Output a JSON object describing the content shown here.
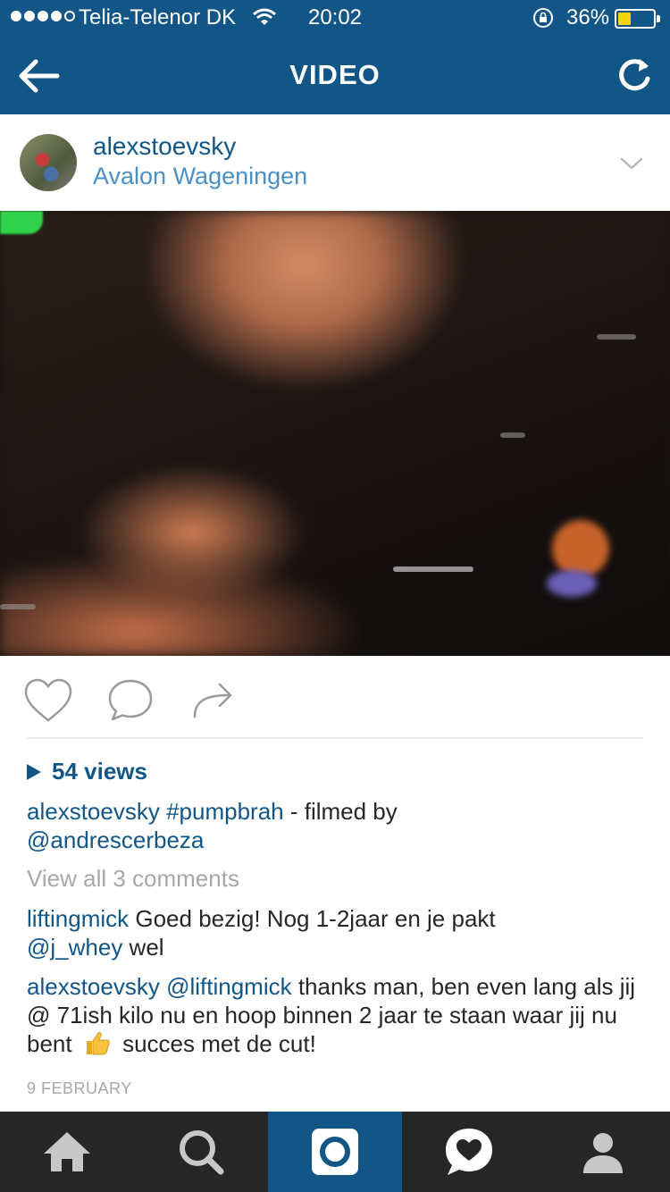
{
  "status_bar": {
    "carrier": "Telia-Telenor DK",
    "time": "20:02",
    "battery_percent": "36%",
    "battery_level": 0.36
  },
  "nav": {
    "title": "VIDEO",
    "back_icon": "back-arrow-icon",
    "refresh_icon": "refresh-icon"
  },
  "post": {
    "username": "alexstoevsky",
    "location": "Avalon Wageningen",
    "views": "54 views",
    "caption": {
      "user": "alexstoevsky",
      "hashtag": "#pumpbrah",
      "text": " - filmed by ",
      "mention": "@andrescerbeza"
    },
    "view_all_comments": "View all 3 comments",
    "comments": [
      {
        "user": "liftingmick",
        "text_before": "Goed bezig! Nog 1-2jaar en je pakt ",
        "mention": "@j_whey",
        "text_after": " wel"
      },
      {
        "user": "alexstoevsky",
        "mention": "@liftingmick",
        "text_before": " thanks man, ben even lang als jij @ 71ish kilo nu en hoop binnen 2 jaar te staan waar jij nu bent",
        "emoji": "thumbs-up-icon",
        "text_after": "succes met de cut!"
      }
    ],
    "date": "9 FEBRUARY"
  },
  "colors": {
    "brand_blue": "#125688",
    "link_blue": "#125688",
    "location_blue": "#4a90c8",
    "tab_bg": "#262626",
    "muted": "#a5a7aa"
  },
  "tabbar": {
    "items": [
      "home-icon",
      "search-icon",
      "camera-icon",
      "activity-icon",
      "profile-icon"
    ],
    "active": "camera-icon"
  }
}
